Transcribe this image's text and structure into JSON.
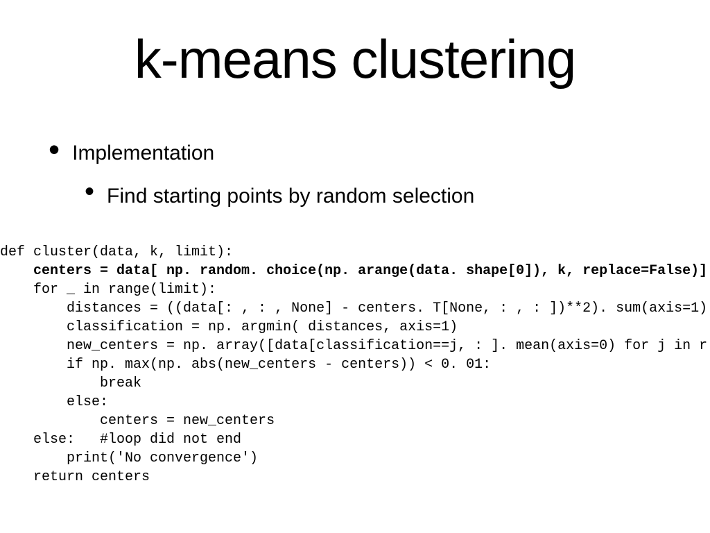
{
  "title": "k-means clustering",
  "bullets": {
    "l1": "Implementation",
    "l2": "Find starting points by random selection"
  },
  "code": {
    "line1": "def cluster(data, k, limit):",
    "line2": "    centers = data[ np. random. choice(np. arange(data. shape[0]), k, replace=False)]",
    "line3": "    for _ in range(limit):",
    "line4": "        distances = ((data[: , : , None] - centers. T[None, : , : ])**2). sum(axis=1)",
    "line5": "        classification = np. argmin( distances, axis=1)",
    "line6": "        new_centers = np. array([data[classification==j, : ]. mean(axis=0) for j in r",
    "line7": "        if np. max(np. abs(new_centers - centers)) < 0. 01:",
    "line8": "            break",
    "line9": "        else:",
    "line10": "            centers = new_centers",
    "line11": "    else:   #loop did not end",
    "line12": "        print('No convergence')",
    "line13": "    return centers"
  }
}
